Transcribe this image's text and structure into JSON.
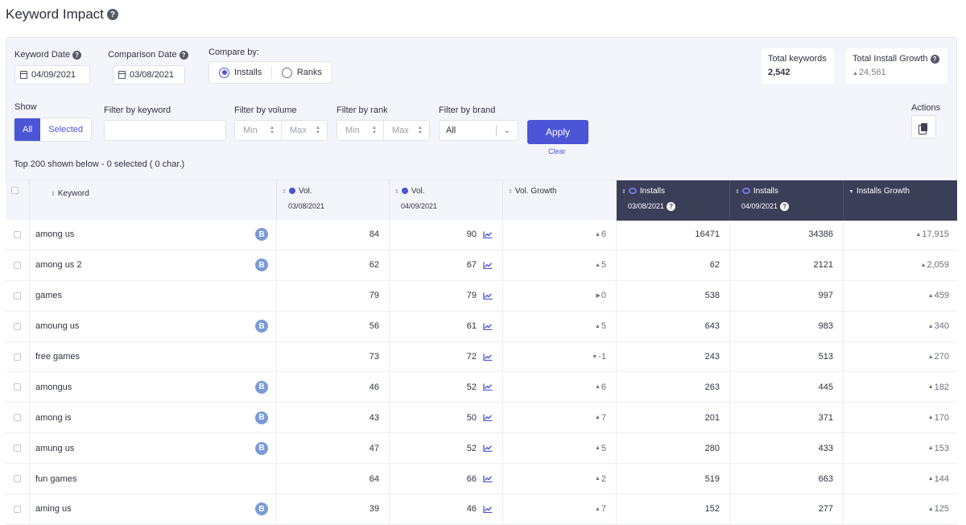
{
  "page": {
    "title": "Keyword Impact"
  },
  "filters": {
    "keyword_date_label": "Keyword Date",
    "keyword_date": "04/09/2021",
    "comparison_date_label": "Comparison Date",
    "comparison_date": "03/08/2021",
    "compare_by_label": "Compare by:",
    "compare_options": [
      "Installs",
      "Ranks"
    ],
    "compare_selected": "Installs",
    "show_label": "Show",
    "show_options": [
      "All",
      "Selected"
    ],
    "filter_keyword_label": "Filter by keyword",
    "filter_volume_label": "Filter by volume",
    "filter_rank_label": "Filter by rank",
    "filter_brand_label": "Filter by brand",
    "min_placeholder": "Min",
    "max_placeholder": "Max",
    "brand_value": "All",
    "apply_label": "Apply",
    "clear_label": "Clear",
    "actions_label": "Actions"
  },
  "stats": {
    "total_keywords_label": "Total keywords",
    "total_keywords": "2,542",
    "total_growth_label": "Total Install Growth",
    "total_growth": "24,561"
  },
  "summary": "Top 200 shown below - 0 selected ( 0 char.)",
  "table": {
    "headers": {
      "keyword": "Keyword",
      "vol1": "Vol.",
      "vol1_date": "03/08/2021",
      "vol2": "Vol.",
      "vol2_date": "04/09/2021",
      "vol_growth": "Vol. Growth",
      "inst1": "Installs",
      "inst1_date": "03/08/2021",
      "inst2": "Installs",
      "inst2_date": "04/09/2021",
      "inst_growth": "Installs Growth"
    },
    "rows": [
      {
        "keyword": "among us",
        "brand": true,
        "vol1": "84",
        "vol2": "90",
        "vol_growth": "6",
        "dir": "up",
        "inst1": "16471",
        "inst2": "34386",
        "inst_growth": "17,915"
      },
      {
        "keyword": "among us 2",
        "brand": true,
        "vol1": "62",
        "vol2": "67",
        "vol_growth": "5",
        "dir": "up",
        "inst1": "62",
        "inst2": "2121",
        "inst_growth": "2,059"
      },
      {
        "keyword": "games",
        "brand": false,
        "vol1": "79",
        "vol2": "79",
        "vol_growth": "0",
        "dir": "flat",
        "inst1": "538",
        "inst2": "997",
        "inst_growth": "459"
      },
      {
        "keyword": "amoung us",
        "brand": true,
        "vol1": "56",
        "vol2": "61",
        "vol_growth": "5",
        "dir": "up",
        "inst1": "643",
        "inst2": "983",
        "inst_growth": "340"
      },
      {
        "keyword": "free games",
        "brand": false,
        "vol1": "73",
        "vol2": "72",
        "vol_growth": "-1",
        "dir": "down",
        "inst1": "243",
        "inst2": "513",
        "inst_growth": "270"
      },
      {
        "keyword": "amongus",
        "brand": true,
        "vol1": "46",
        "vol2": "52",
        "vol_growth": "6",
        "dir": "up",
        "inst1": "263",
        "inst2": "445",
        "inst_growth": "182"
      },
      {
        "keyword": "among is",
        "brand": true,
        "vol1": "43",
        "vol2": "50",
        "vol_growth": "7",
        "dir": "up",
        "inst1": "201",
        "inst2": "371",
        "inst_growth": "170"
      },
      {
        "keyword": "amung us",
        "brand": true,
        "vol1": "47",
        "vol2": "52",
        "vol_growth": "5",
        "dir": "up",
        "inst1": "280",
        "inst2": "433",
        "inst_growth": "153"
      },
      {
        "keyword": "fun games",
        "brand": false,
        "vol1": "64",
        "vol2": "66",
        "vol_growth": "2",
        "dir": "up",
        "inst1": "519",
        "inst2": "663",
        "inst_growth": "144"
      },
      {
        "keyword": "aming us",
        "brand": true,
        "vol1": "39",
        "vol2": "46",
        "vol_growth": "7",
        "dir": "up",
        "inst1": "152",
        "inst2": "277",
        "inst_growth": "125"
      }
    ]
  },
  "brand_badge": "B",
  "colors": {
    "accent": "#4b55d6",
    "header_dark": "#3b3e57",
    "badge": "#7a9bd6"
  }
}
